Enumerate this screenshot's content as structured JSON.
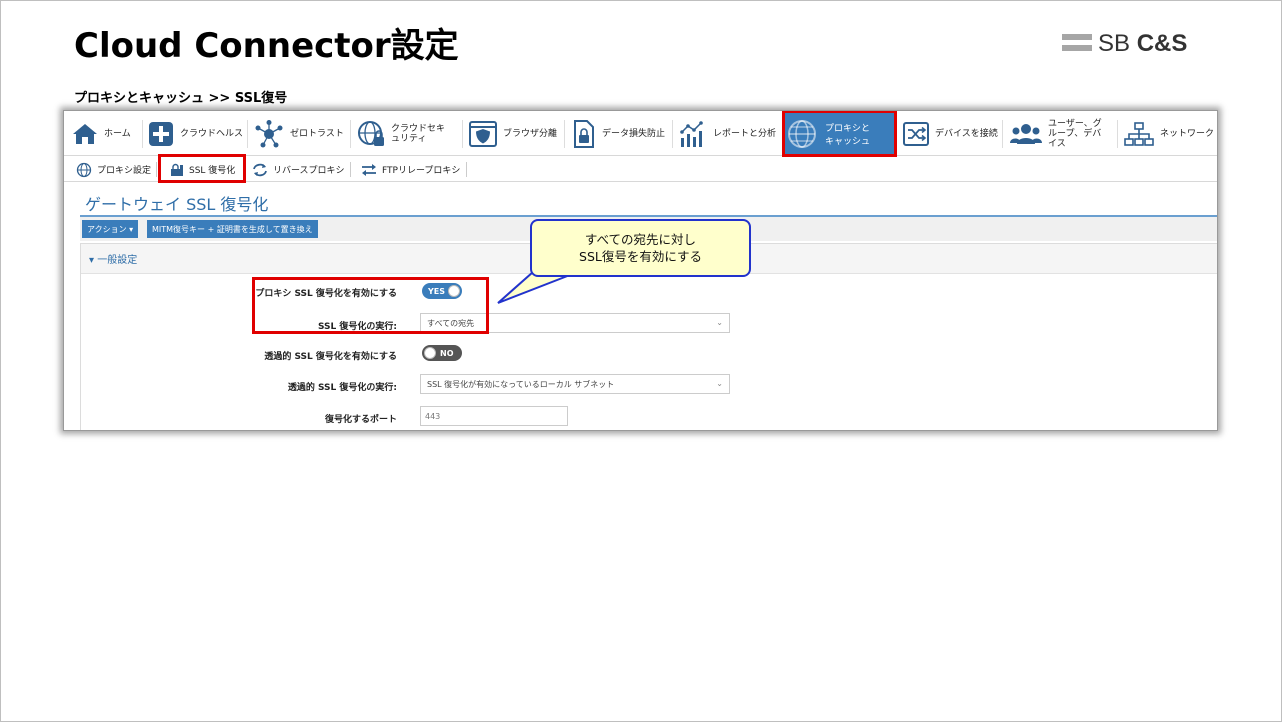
{
  "slide": {
    "title": "Cloud Connector設定",
    "breadcrumb": "プロキシとキャッシュ >> SSL復号",
    "logo_sb": "SB",
    "logo_cs": "C&S"
  },
  "topnav": {
    "items": [
      {
        "label": "ホーム",
        "icon": "home-icon"
      },
      {
        "label": "クラウドヘルス",
        "icon": "plus-icon"
      },
      {
        "label": "ゼロトラスト",
        "icon": "network-nodes-icon"
      },
      {
        "label": "クラウドセキュリティ",
        "icon": "globe-lock-icon"
      },
      {
        "label": "ブラウザ分離",
        "icon": "shield-browser-icon"
      },
      {
        "label": "データ損失防止",
        "icon": "file-lock-icon"
      },
      {
        "label": "レポートと分析",
        "icon": "chart-icon"
      },
      {
        "label": "プロキシとキャッシュ",
        "icon": "globe-icon",
        "active": true
      },
      {
        "label": "デバイスを接続",
        "icon": "shuffle-icon"
      },
      {
        "label": "ユーザー、グループ、デバイス",
        "icon": "users-icon"
      },
      {
        "label": "ネットワーク",
        "icon": "sitemap-icon"
      }
    ]
  },
  "subnav": {
    "items": [
      {
        "label": "プロキシ設定",
        "icon": "globe-settings-icon"
      },
      {
        "label": "SSL 復号化",
        "icon": "ssl-lock-icon",
        "active": true
      },
      {
        "label": "リバースプロキシ",
        "icon": "refresh-icon"
      },
      {
        "label": "FTPリレープロキシ",
        "icon": "arrows-icon"
      }
    ]
  },
  "page": {
    "heading": "ゲートウェイ SSL 復号化",
    "action_button": "アクション ▾",
    "mitm_button": "MITM復号キー + 証明書を生成して置き換え",
    "section_title": "▾ 一般設定"
  },
  "form": {
    "enable_ssl_label": "プロキシ SSL 復号化を有効にする",
    "enable_ssl_value": "YES",
    "ssl_exec_label": "SSL 復号化の実行:",
    "ssl_exec_value": "すべての宛先",
    "transparent_label": "透過的 SSL 復号化を有効にする",
    "transparent_value": "NO",
    "transparent_exec_label": "透過的 SSL 復号化の実行:",
    "transparent_exec_value": "SSL 復号化が有効になっているローカル サブネット",
    "port_label": "復号化するポート",
    "port_value": "443"
  },
  "callout": {
    "line1": "すべての宛先に対し",
    "line2": "SSL復号を有効にする"
  },
  "colors": {
    "accent": "#3a7dbb",
    "highlight": "#e00000",
    "callout_fill": "#ffffcc",
    "callout_border": "#2233cc"
  }
}
